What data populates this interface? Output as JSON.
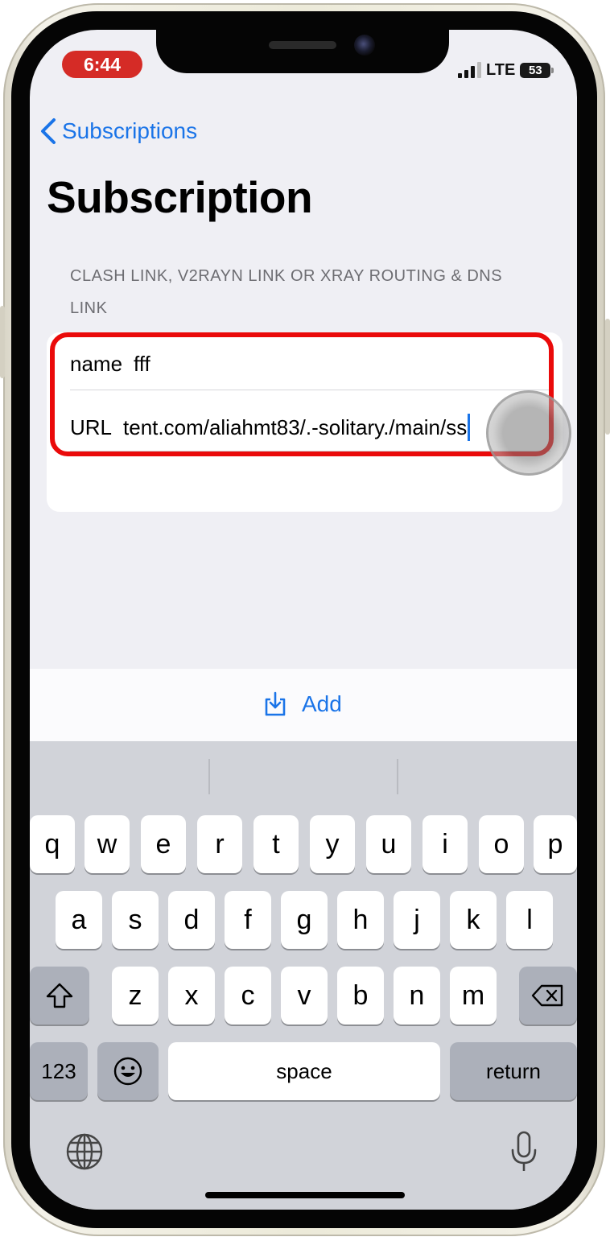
{
  "status_bar": {
    "time": "6:44",
    "network": "LTE",
    "battery": "53"
  },
  "nav": {
    "back_label": "Subscriptions",
    "title": "Subscription"
  },
  "section_header": "CLASH LINK, V2RAYN LINK OR XRAY ROUTING & DNS LINK",
  "form": {
    "name_label": "name",
    "name_value": "fff",
    "url_label": "URL",
    "url_value": "tent.com/aliahmt83/.-solitary./main/ss"
  },
  "add_button_label": "Add",
  "keyboard": {
    "row1": [
      "q",
      "w",
      "e",
      "r",
      "t",
      "y",
      "u",
      "i",
      "o",
      "p"
    ],
    "row2": [
      "a",
      "s",
      "d",
      "f",
      "g",
      "h",
      "j",
      "k",
      "l"
    ],
    "row3": [
      "z",
      "x",
      "c",
      "v",
      "b",
      "n",
      "m"
    ],
    "numbers_label": "123",
    "space_label": "space",
    "return_label": "return"
  },
  "colors": {
    "accent": "#1a74e8",
    "highlight": "#ea0a0a",
    "time_pill": "#d52b26"
  }
}
